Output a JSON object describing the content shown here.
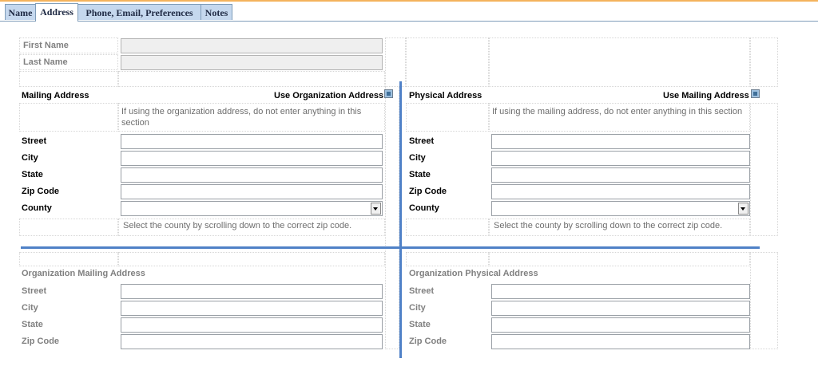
{
  "tabs": [
    {
      "label": "Name",
      "active": false
    },
    {
      "label": "Address",
      "active": true
    },
    {
      "label": "Phone, Email, Preferences",
      "active": false
    },
    {
      "label": "Notes",
      "active": false
    }
  ],
  "name_section": {
    "first_name_label": "First Name",
    "first_name_value": "",
    "last_name_label": "Last Name",
    "last_name_value": ""
  },
  "mailing": {
    "heading": "Mailing Address",
    "use_label": "Use Organization Address",
    "use_checked": true,
    "note": "If using the organization address, do not enter anything in this section",
    "street_label": "Street",
    "city_label": "City",
    "state_label": "State",
    "zip_label": "Zip Code",
    "county_label": "County",
    "county_note": "Select the county by scrolling down to the correct zip code."
  },
  "physical": {
    "heading": "Physical Address",
    "use_label": "Use Mailing Address",
    "use_checked": true,
    "note": "If using the mailing address, do not enter anything in this section",
    "street_label": "Street",
    "city_label": "City",
    "state_label": "State",
    "zip_label": "Zip Code",
    "county_label": "County",
    "county_note": "Select the county by scrolling down to the correct zip code."
  },
  "org_mailing": {
    "heading": "Organization Mailing Address",
    "street_label": "Street",
    "city_label": "City",
    "state_label": "State",
    "zip_label": "Zip Code"
  },
  "org_physical": {
    "heading": "Organization Physical Address",
    "street_label": "Street",
    "city_label": "City",
    "state_label": "State",
    "zip_label": "Zip Code"
  },
  "colors": {
    "tab_bg": "#c5d8ee",
    "divider": "#4f81c7",
    "top_accent": "#f4b35c"
  }
}
